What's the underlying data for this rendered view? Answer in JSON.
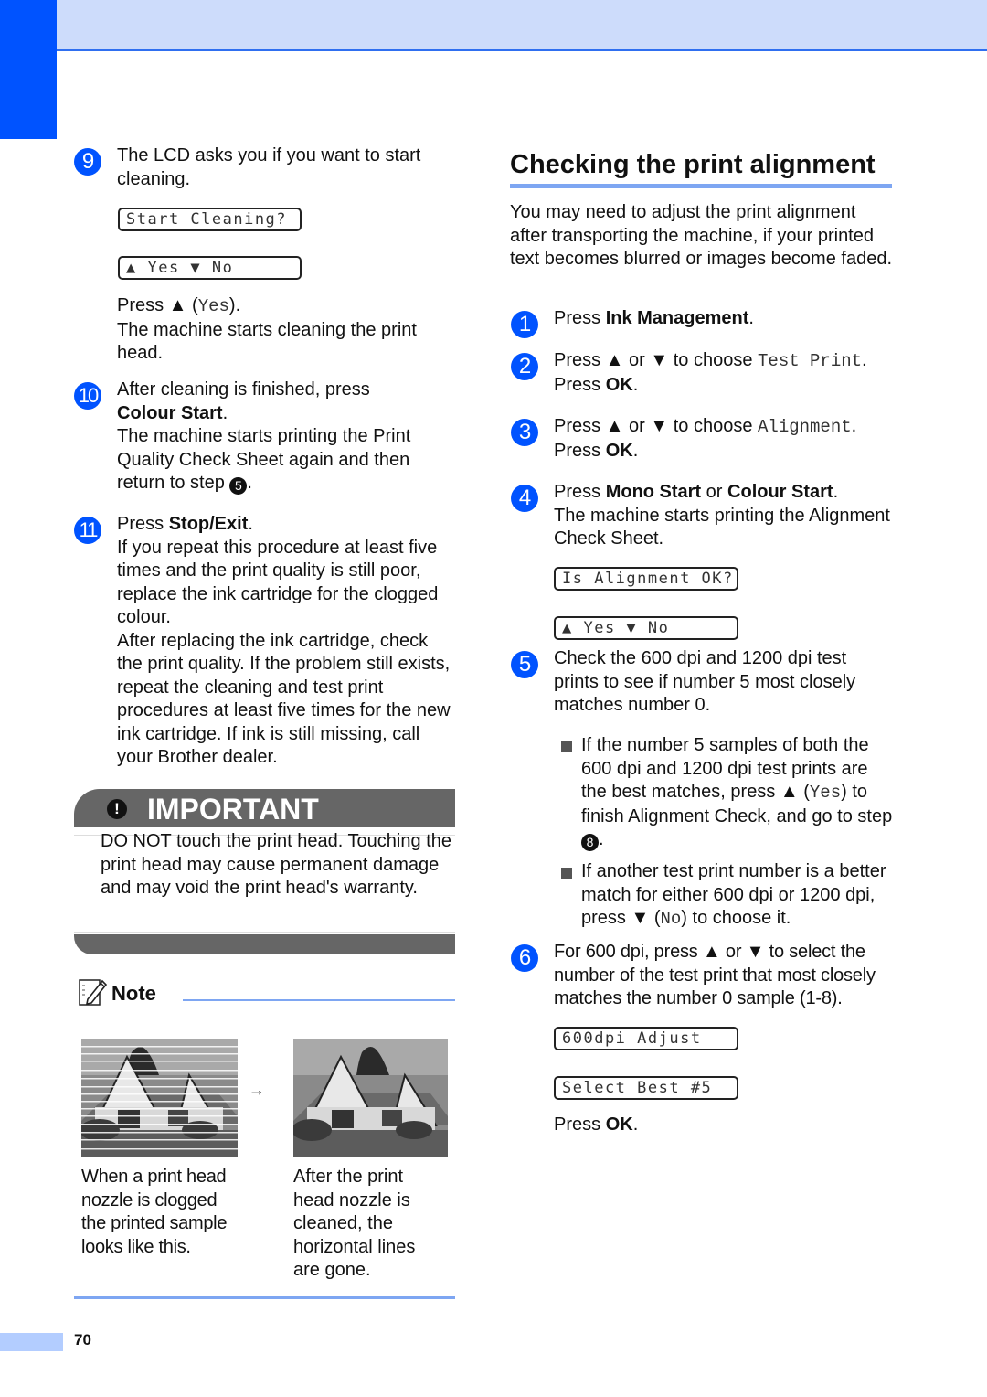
{
  "left_column": {
    "step9": {
      "number": "9",
      "text": "The LCD asks you if you want to start cleaning.",
      "lcd_line1": "Start Cleaning?",
      "lcd_line2": "▲ Yes ▼ No",
      "press_prefix": "Press ▲ (",
      "press_key": "Yes",
      "press_suffix": ").",
      "after": "The machine starts cleaning the print head."
    },
    "step10": {
      "number": "10",
      "text_prefix": "After cleaning is finished, press",
      "button": "Colour Start",
      "period": ".",
      "after": "The machine starts printing the Print Quality Check Sheet again and then return to step ",
      "step_ref": "5",
      "end": "."
    },
    "step11": {
      "number": "11",
      "text_prefix": "Press ",
      "button": "Stop/Exit",
      "period": ".",
      "para1": "If you repeat this procedure at least five times and the print quality is still poor, replace the ink cartridge for the clogged colour.",
      "para2": "After replacing the ink cartridge, check the print quality. If the problem still exists, repeat the cleaning and test print procedures at least five times for the new ink cartridge. If ink is still missing, call your Brother dealer."
    },
    "important": {
      "icon": "!",
      "title": "IMPORTANT",
      "text": "DO NOT touch the print head. Touching the print head may cause permanent damage and may void the print head's warranty."
    },
    "note": {
      "title": "Note",
      "arrow": "→",
      "caption_before": "When a print head nozzle is clogged the printed sample looks like this.",
      "caption_after": "After the print head nozzle is cleaned, the horizontal lines are gone."
    }
  },
  "right_column": {
    "section_title": "Checking the print alignment",
    "intro": "You may need to adjust the print alignment after transporting the machine, if your printed text becomes blurred or images become faded.",
    "step1": {
      "number": "1",
      "prefix": "Press ",
      "button": "Ink Management",
      "suffix": "."
    },
    "step2": {
      "number": "2",
      "prefix": "Press ▲ or ▼ to choose ",
      "menu": "Test Print",
      "suffix": ".",
      "press": "Press ",
      "ok": "OK",
      "end": "."
    },
    "step3": {
      "number": "3",
      "prefix": "Press ▲ or ▼ to choose ",
      "menu": "Alignment",
      "suffix": ".",
      "press": "Press ",
      "ok": "OK",
      "end": "."
    },
    "step4": {
      "number": "4",
      "prefix": "Press ",
      "button1": "Mono Start",
      "or": " or ",
      "button2": "Colour Start",
      "suffix": ".",
      "after": "The machine starts printing the Alignment Check Sheet.",
      "lcd_line1": "Is Alignment OK?",
      "lcd_line2": "▲ Yes ▼ No"
    },
    "step5": {
      "number": "5",
      "text": "Check the 600 dpi and 1200 dpi test prints to see if number 5 most closely matches number 0.",
      "bullet1_a": "If the number 5 samples of both the 600 dpi and 1200 dpi test prints are the best matches, press ▲ (",
      "bullet1_key": "Yes",
      "bullet1_b": ") to finish Alignment Check, and go to step ",
      "bullet1_ref": "8",
      "bullet1_end": ".",
      "bullet2_a": "If another test print number is a better match for either 600 dpi or 1200 dpi, press ▼ (",
      "bullet2_key": "No",
      "bullet2_b": ") to choose it."
    },
    "step6": {
      "number": "6",
      "text": "For 600 dpi, press ▲ or ▼ to select the number of the test print that most closely matches the number 0 sample (1-8).",
      "lcd_line1": "600dpi Adjust",
      "lcd_line2": "Select Best #5",
      "press": "Press ",
      "ok": "OK",
      "end": "."
    }
  },
  "footer": {
    "page_number": "70"
  },
  "colors": {
    "brand_blue": "#0053ff",
    "band_blue": "#cddcfb",
    "rule_blue": "#7ea6f2",
    "important_gray": "#666666"
  }
}
